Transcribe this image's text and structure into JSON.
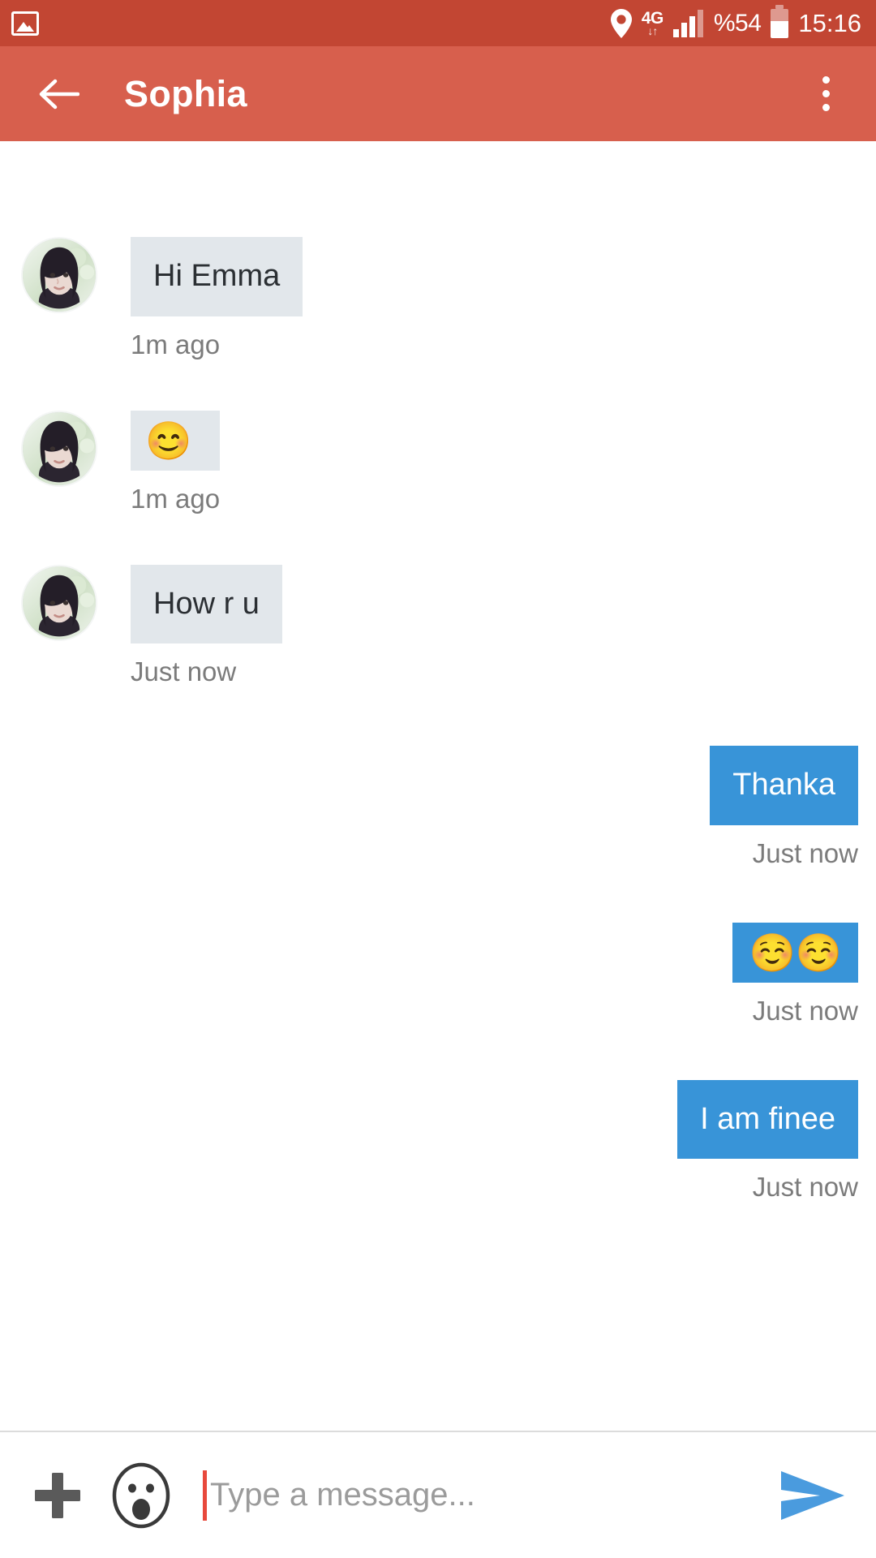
{
  "status_bar": {
    "background": "#C24633",
    "gallery_icon": "image-icon",
    "location_icon": "location-pin-icon",
    "network_label": "4G",
    "network_arrows": "↓↑",
    "signal_icon": "signal-bars-icon",
    "battery_percent": "%54",
    "battery_icon": "battery-icon",
    "time": "15:16"
  },
  "app_bar": {
    "background": "#D75F4D",
    "back_icon": "back-arrow-icon",
    "title": "Sophia",
    "overflow_icon": "more-vertical-icon"
  },
  "colors": {
    "incoming_bubble": "#E2E7EB",
    "outgoing_bubble": "#3894D8",
    "timestamp_text": "#7B7B7B",
    "caret": "#E8493C",
    "send_icon": "#4A9BDE"
  },
  "messages": [
    {
      "id": "m1",
      "side": "in",
      "type": "text",
      "text": "Hi Emma",
      "time": "1m ago",
      "avatar": "contact-avatar"
    },
    {
      "id": "m2",
      "side": "in",
      "type": "emoji",
      "text": "😊",
      "time": "1m ago",
      "avatar": "contact-avatar"
    },
    {
      "id": "m3",
      "side": "in",
      "type": "text",
      "text": "How r u",
      "time": "Just now",
      "avatar": "contact-avatar"
    },
    {
      "id": "m4",
      "side": "out",
      "type": "text",
      "text": "Thanka",
      "time": "Just now"
    },
    {
      "id": "m5",
      "side": "out",
      "type": "emoji",
      "text": "☺️☺️",
      "time": "Just now"
    },
    {
      "id": "m6",
      "side": "out",
      "type": "text",
      "text": "I am finee",
      "time": "Just now"
    }
  ],
  "input_bar": {
    "attach_icon": "plus-icon",
    "emoji_icon": "emoji-face-icon",
    "placeholder": "Type a message...",
    "value": "",
    "send_icon": "send-arrow-icon"
  }
}
